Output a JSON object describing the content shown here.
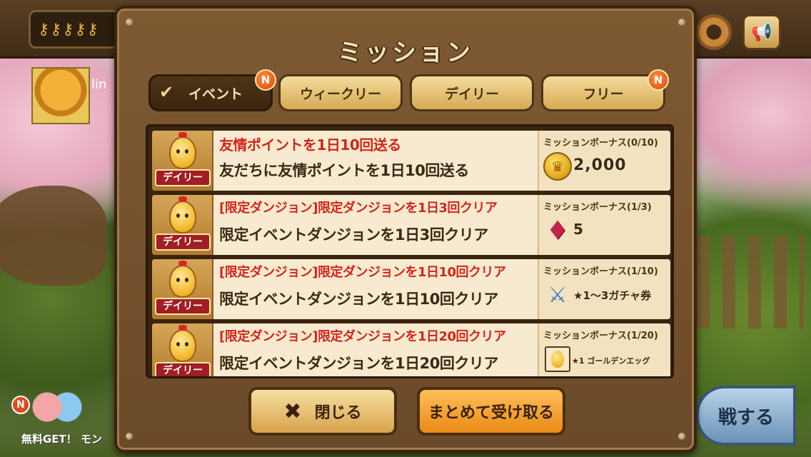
{
  "modal": {
    "title": "ミッション",
    "tabs": [
      {
        "label": "イベント",
        "active": true,
        "badge": "N"
      },
      {
        "label": "ウィークリー",
        "active": false,
        "badge": ""
      },
      {
        "label": "デイリー",
        "active": false,
        "badge": ""
      },
      {
        "label": "フリー",
        "active": false,
        "badge": "N"
      }
    ],
    "missions": [
      {
        "tag": "デイリー",
        "title": "友情ポイントを1日10回送る",
        "description": "友だちに友情ポイントを1日10回送る",
        "bonus_header": "ミッションボーナス(0/10)",
        "reward_icon": "coin-icon",
        "reward_value": "2,000"
      },
      {
        "tag": "デイリー",
        "title": "[限定ダンジョン]限定ダンジョンを1日3回クリア",
        "description": "限定イベントダンジョンを1日3回クリア",
        "bonus_header": "ミッションボーナス(1/3)",
        "reward_icon": "gem-icon",
        "reward_value": "5"
      },
      {
        "tag": "デイリー",
        "title": "[限定ダンジョン]限定ダンジョンを1日10回クリア",
        "description": "限定イベントダンジョンを1日10回クリア",
        "bonus_header": "ミッションボーナス(1/10)",
        "reward_icon": "gacha-ticket-icon",
        "reward_value": "★1～3ガチャ券"
      },
      {
        "tag": "デイリー",
        "title": "[限定ダンジョン]限定ダンジョンを1日20回クリア",
        "description": "限定イベントダンジョンを1日20回クリア",
        "bonus_header": "ミッションボーナス(1/20)",
        "reward_icon": "golden-egg-icon",
        "reward_value": "★1 ゴールデンエッグ"
      }
    ],
    "close_label": "閉じる",
    "collect_all_label": "まとめて受け取る"
  },
  "background": {
    "avatar_name": "lin",
    "bottom_left_label": "無料GET！ モン",
    "bottom_left_badge": "N",
    "battle_label": "戦する"
  },
  "colors": {
    "modal_wood": "#6b4a29",
    "tab_active": "#3a250e",
    "tab_inactive": "#e8c57a",
    "mission_title_red": "#d2251a",
    "collect_button": "#e98a17",
    "badge": "#e04a0e"
  }
}
